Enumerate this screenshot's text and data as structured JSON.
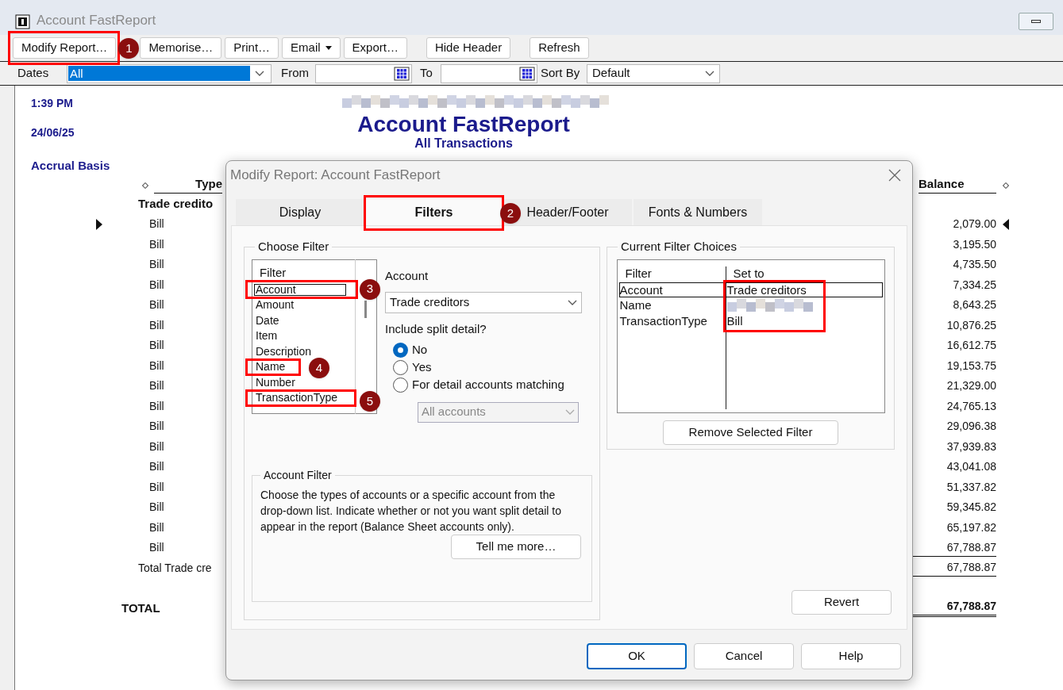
{
  "window": {
    "title": "Account FastReport"
  },
  "toolbar": [
    {
      "label": "Modify Report…",
      "kind": "button",
      "callout": "1"
    },
    {
      "label": "Memorise…",
      "kind": "button"
    },
    {
      "label": "Print…",
      "kind": "button"
    },
    {
      "label": "Email",
      "kind": "menu"
    },
    {
      "label": "Export…",
      "kind": "button"
    },
    {
      "label": "Hide Header",
      "kind": "button"
    },
    {
      "label": "Refresh",
      "kind": "button"
    }
  ],
  "filter_bar": {
    "dates_label": "Dates",
    "dates_value": "All",
    "from_label": "From",
    "to_label": "To",
    "sort_label": "Sort By",
    "sort_value": "Default"
  },
  "report": {
    "time": "1:39 PM",
    "date": "24/06/25",
    "basis": "Accrual Basis",
    "title": "Account FastReport",
    "subtitle": "All Transactions",
    "columns": [
      "Type",
      "Balance"
    ],
    "group": "Trade credito",
    "rows": [
      {
        "type": "Bill",
        "balance": "2,079.00",
        "selected": true
      },
      {
        "type": "Bill",
        "balance": "3,195.50",
        "selected": false
      },
      {
        "type": "Bill",
        "balance": "4,735.50",
        "selected": false
      },
      {
        "type": "Bill",
        "balance": "7,334.25",
        "selected": false
      },
      {
        "type": "Bill",
        "balance": "8,643.25",
        "selected": false
      },
      {
        "type": "Bill",
        "balance": "10,876.25",
        "selected": false
      },
      {
        "type": "Bill",
        "balance": "16,612.75",
        "selected": false
      },
      {
        "type": "Bill",
        "balance": "19,153.75",
        "selected": false
      },
      {
        "type": "Bill",
        "balance": "21,329.00",
        "selected": false
      },
      {
        "type": "Bill",
        "balance": "24,765.13",
        "selected": false
      },
      {
        "type": "Bill",
        "balance": "29,096.38",
        "selected": false
      },
      {
        "type": "Bill",
        "balance": "37,939.83",
        "selected": false
      },
      {
        "type": "Bill",
        "balance": "43,041.08",
        "selected": false
      },
      {
        "type": "Bill",
        "balance": "51,337.82",
        "selected": false
      },
      {
        "type": "Bill",
        "balance": "59,345.82",
        "selected": false
      },
      {
        "type": "Bill",
        "balance": "65,197.82",
        "selected": false
      },
      {
        "type": "Bill",
        "balance": "67,788.87",
        "selected": false
      }
    ],
    "group_total": {
      "label": "Total Trade cre",
      "balance": "67,788.87"
    },
    "total": {
      "label": "TOTAL",
      "balance": "67,788.87"
    }
  },
  "dialog": {
    "title": "Modify Report: Account FastReport",
    "tabs": [
      {
        "label": "Display",
        "selected": false
      },
      {
        "label": "Filters",
        "selected": true,
        "callout": "2"
      },
      {
        "label": "Header/Footer",
        "selected": false
      },
      {
        "label": "Fonts & Numbers",
        "selected": false
      }
    ],
    "choose_filter": {
      "title": "Choose Filter",
      "list_header": "Filter",
      "items": [
        {
          "label": "Account",
          "selected": true,
          "callout": "3"
        },
        {
          "label": "Amount",
          "selected": false
        },
        {
          "label": "Date",
          "selected": false
        },
        {
          "label": "Item",
          "selected": false
        },
        {
          "label": "Description",
          "selected": false
        },
        {
          "label": "Name",
          "selected": false,
          "callout": "4"
        },
        {
          "label": "Number",
          "selected": false
        },
        {
          "label": "TransactionType",
          "selected": false,
          "callout": "5"
        }
      ]
    },
    "account": {
      "label": "Account",
      "value": "Trade creditors"
    },
    "split": {
      "label": "Include split detail?",
      "options": [
        {
          "label": "No",
          "selected": true
        },
        {
          "label": "Yes",
          "selected": false
        },
        {
          "label": "For detail accounts matching",
          "selected": false
        }
      ]
    },
    "detail_accounts": {
      "value": "All accounts",
      "disabled": true
    },
    "account_filter": {
      "title": "Account Filter",
      "text": "Choose the types of accounts or a specific account from the drop-down list. Indicate whether or not you want split detail to appear in the report (Balance Sheet accounts only).",
      "button": "Tell me more…"
    },
    "current": {
      "title": "Current Filter Choices",
      "columns": [
        "Filter",
        "Set to"
      ],
      "highlight_values": true,
      "rows": [
        {
          "filter": "Account",
          "set_to": "Trade creditors",
          "selected": true
        },
        {
          "filter": "Name",
          "selected": false
        },
        {
          "filter": "TransactionType",
          "set_to": "Bill",
          "selected": false
        }
      ],
      "remove_button": "Remove Selected Filter"
    },
    "revert_button": "Revert",
    "buttons": [
      {
        "label": "OK",
        "default": true
      },
      {
        "label": "Cancel",
        "default": false
      },
      {
        "label": "Help",
        "default": false
      }
    ]
  }
}
